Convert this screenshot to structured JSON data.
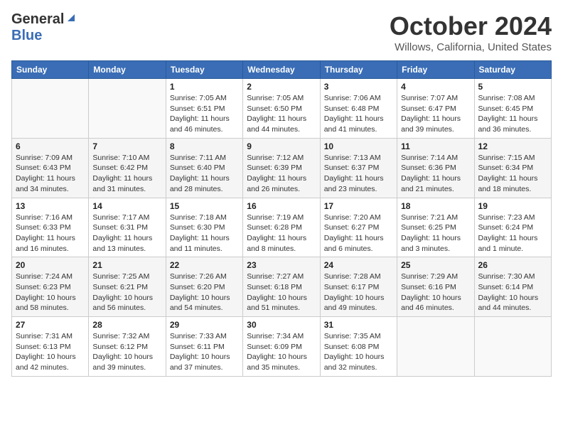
{
  "header": {
    "logo_general": "General",
    "logo_blue": "Blue",
    "month": "October 2024",
    "location": "Willows, California, United States"
  },
  "days_of_week": [
    "Sunday",
    "Monday",
    "Tuesday",
    "Wednesday",
    "Thursday",
    "Friday",
    "Saturday"
  ],
  "weeks": [
    [
      {
        "day": "",
        "info": ""
      },
      {
        "day": "",
        "info": ""
      },
      {
        "day": "1",
        "info": "Sunrise: 7:05 AM\nSunset: 6:51 PM\nDaylight: 11 hours and 46 minutes."
      },
      {
        "day": "2",
        "info": "Sunrise: 7:05 AM\nSunset: 6:50 PM\nDaylight: 11 hours and 44 minutes."
      },
      {
        "day": "3",
        "info": "Sunrise: 7:06 AM\nSunset: 6:48 PM\nDaylight: 11 hours and 41 minutes."
      },
      {
        "day": "4",
        "info": "Sunrise: 7:07 AM\nSunset: 6:47 PM\nDaylight: 11 hours and 39 minutes."
      },
      {
        "day": "5",
        "info": "Sunrise: 7:08 AM\nSunset: 6:45 PM\nDaylight: 11 hours and 36 minutes."
      }
    ],
    [
      {
        "day": "6",
        "info": "Sunrise: 7:09 AM\nSunset: 6:43 PM\nDaylight: 11 hours and 34 minutes."
      },
      {
        "day": "7",
        "info": "Sunrise: 7:10 AM\nSunset: 6:42 PM\nDaylight: 11 hours and 31 minutes."
      },
      {
        "day": "8",
        "info": "Sunrise: 7:11 AM\nSunset: 6:40 PM\nDaylight: 11 hours and 28 minutes."
      },
      {
        "day": "9",
        "info": "Sunrise: 7:12 AM\nSunset: 6:39 PM\nDaylight: 11 hours and 26 minutes."
      },
      {
        "day": "10",
        "info": "Sunrise: 7:13 AM\nSunset: 6:37 PM\nDaylight: 11 hours and 23 minutes."
      },
      {
        "day": "11",
        "info": "Sunrise: 7:14 AM\nSunset: 6:36 PM\nDaylight: 11 hours and 21 minutes."
      },
      {
        "day": "12",
        "info": "Sunrise: 7:15 AM\nSunset: 6:34 PM\nDaylight: 11 hours and 18 minutes."
      }
    ],
    [
      {
        "day": "13",
        "info": "Sunrise: 7:16 AM\nSunset: 6:33 PM\nDaylight: 11 hours and 16 minutes."
      },
      {
        "day": "14",
        "info": "Sunrise: 7:17 AM\nSunset: 6:31 PM\nDaylight: 11 hours and 13 minutes."
      },
      {
        "day": "15",
        "info": "Sunrise: 7:18 AM\nSunset: 6:30 PM\nDaylight: 11 hours and 11 minutes."
      },
      {
        "day": "16",
        "info": "Sunrise: 7:19 AM\nSunset: 6:28 PM\nDaylight: 11 hours and 8 minutes."
      },
      {
        "day": "17",
        "info": "Sunrise: 7:20 AM\nSunset: 6:27 PM\nDaylight: 11 hours and 6 minutes."
      },
      {
        "day": "18",
        "info": "Sunrise: 7:21 AM\nSunset: 6:25 PM\nDaylight: 11 hours and 3 minutes."
      },
      {
        "day": "19",
        "info": "Sunrise: 7:23 AM\nSunset: 6:24 PM\nDaylight: 11 hours and 1 minute."
      }
    ],
    [
      {
        "day": "20",
        "info": "Sunrise: 7:24 AM\nSunset: 6:23 PM\nDaylight: 10 hours and 58 minutes."
      },
      {
        "day": "21",
        "info": "Sunrise: 7:25 AM\nSunset: 6:21 PM\nDaylight: 10 hours and 56 minutes."
      },
      {
        "day": "22",
        "info": "Sunrise: 7:26 AM\nSunset: 6:20 PM\nDaylight: 10 hours and 54 minutes."
      },
      {
        "day": "23",
        "info": "Sunrise: 7:27 AM\nSunset: 6:18 PM\nDaylight: 10 hours and 51 minutes."
      },
      {
        "day": "24",
        "info": "Sunrise: 7:28 AM\nSunset: 6:17 PM\nDaylight: 10 hours and 49 minutes."
      },
      {
        "day": "25",
        "info": "Sunrise: 7:29 AM\nSunset: 6:16 PM\nDaylight: 10 hours and 46 minutes."
      },
      {
        "day": "26",
        "info": "Sunrise: 7:30 AM\nSunset: 6:14 PM\nDaylight: 10 hours and 44 minutes."
      }
    ],
    [
      {
        "day": "27",
        "info": "Sunrise: 7:31 AM\nSunset: 6:13 PM\nDaylight: 10 hours and 42 minutes."
      },
      {
        "day": "28",
        "info": "Sunrise: 7:32 AM\nSunset: 6:12 PM\nDaylight: 10 hours and 39 minutes."
      },
      {
        "day": "29",
        "info": "Sunrise: 7:33 AM\nSunset: 6:11 PM\nDaylight: 10 hours and 37 minutes."
      },
      {
        "day": "30",
        "info": "Sunrise: 7:34 AM\nSunset: 6:09 PM\nDaylight: 10 hours and 35 minutes."
      },
      {
        "day": "31",
        "info": "Sunrise: 7:35 AM\nSunset: 6:08 PM\nDaylight: 10 hours and 32 minutes."
      },
      {
        "day": "",
        "info": ""
      },
      {
        "day": "",
        "info": ""
      }
    ]
  ]
}
